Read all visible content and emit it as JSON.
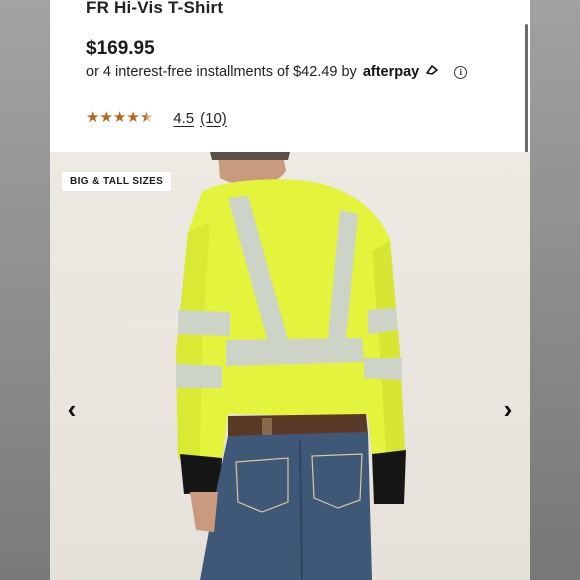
{
  "product": {
    "title": "FR Hi-Vis T-Shirt",
    "price": "$169.95",
    "installment_text": "or 4 interest-free installments of $42.49 by",
    "afterpay_label": "afterpay",
    "info_glyph": "i",
    "rating": {
      "stars": 4.5,
      "value_label": "4.5",
      "count_label": "(10)"
    }
  },
  "gallery": {
    "badge": "BIG & TALL SIZES",
    "prev_glyph": "‹",
    "next_glyph": "›"
  },
  "colors": {
    "star": "#b5651d",
    "shirt": "#e6f43a",
    "reflective": "#c9cfc4",
    "jeans": "#3f5878"
  },
  "icons": [
    "star-icon",
    "afterpay-loop-icon",
    "info-icon",
    "chevron-left-icon",
    "chevron-right-icon"
  ]
}
